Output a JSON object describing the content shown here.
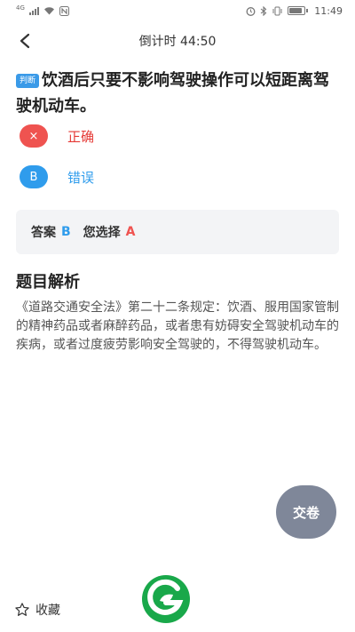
{
  "status_bar": {
    "left_label": "4G",
    "time": "11:49"
  },
  "header": {
    "title": "倒计时 44:50"
  },
  "question": {
    "tag": "判断",
    "text": "饮酒后只要不影响驾驶操作可以短距离驾驶机动车。"
  },
  "options": [
    {
      "marker": "×",
      "text": "正确",
      "state": "wrong"
    },
    {
      "marker": "B",
      "text": "错误",
      "state": "correct"
    }
  ],
  "answer": {
    "answer_label": "答案",
    "answer_value": "B",
    "choice_label": "您选择",
    "choice_value": "A"
  },
  "analysis": {
    "title": "题目解析",
    "text": "《道路交通安全法》第二十二条规定：饮酒、服用国家管制的精神药品或者麻醉药品，或者患有妨碍安全驾驶机动车的疾病，或者过度疲劳影响安全驾驶的，不得驾驶机动车。"
  },
  "submit_label": "交卷",
  "favorite_label": "收藏",
  "colors": {
    "accent_blue": "#2f9cec",
    "error_red": "#ef5350",
    "submit_gray": "#7f8799",
    "logo_green": "#19a84a"
  },
  "icons": [
    "signal-icon",
    "wifi-icon",
    "nfc-icon",
    "alarm-icon",
    "bluetooth-icon",
    "vibrate-icon",
    "battery-icon",
    "back-arrow-icon",
    "star-icon",
    "logo-icon"
  ]
}
